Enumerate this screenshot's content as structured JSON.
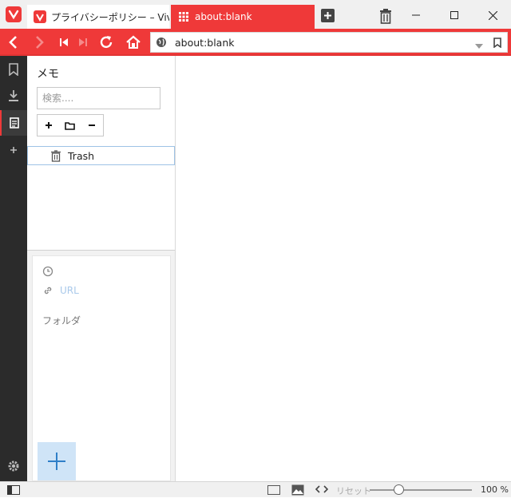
{
  "tabs": [
    {
      "label": "プライバシーポリシー – Vivaldi",
      "active": false
    },
    {
      "label": "about:blank",
      "active": true
    }
  ],
  "address": {
    "url": "about:blank"
  },
  "notes_panel": {
    "title": "メモ",
    "search_placeholder": "検索....",
    "tree": [
      {
        "label": "Trash"
      }
    ],
    "editor": {
      "url_placeholder": "URL",
      "folder_label": "フォルダ"
    }
  },
  "status": {
    "reset_label": "リセット",
    "zoom": "100 %",
    "zoom_fraction": 0.25
  },
  "colors": {
    "accent": "#ef3939",
    "panel_dark": "#2b2b2b",
    "selection": "#9ec3e6"
  },
  "icons": [
    "vivaldi-logo",
    "new-tab",
    "trash",
    "back",
    "forward",
    "rewind",
    "fast-forward",
    "reload",
    "home",
    "globe",
    "bookmark",
    "download",
    "notes",
    "add-panel",
    "clock",
    "link",
    "settings",
    "panel-toggle",
    "tile",
    "image",
    "code"
  ]
}
